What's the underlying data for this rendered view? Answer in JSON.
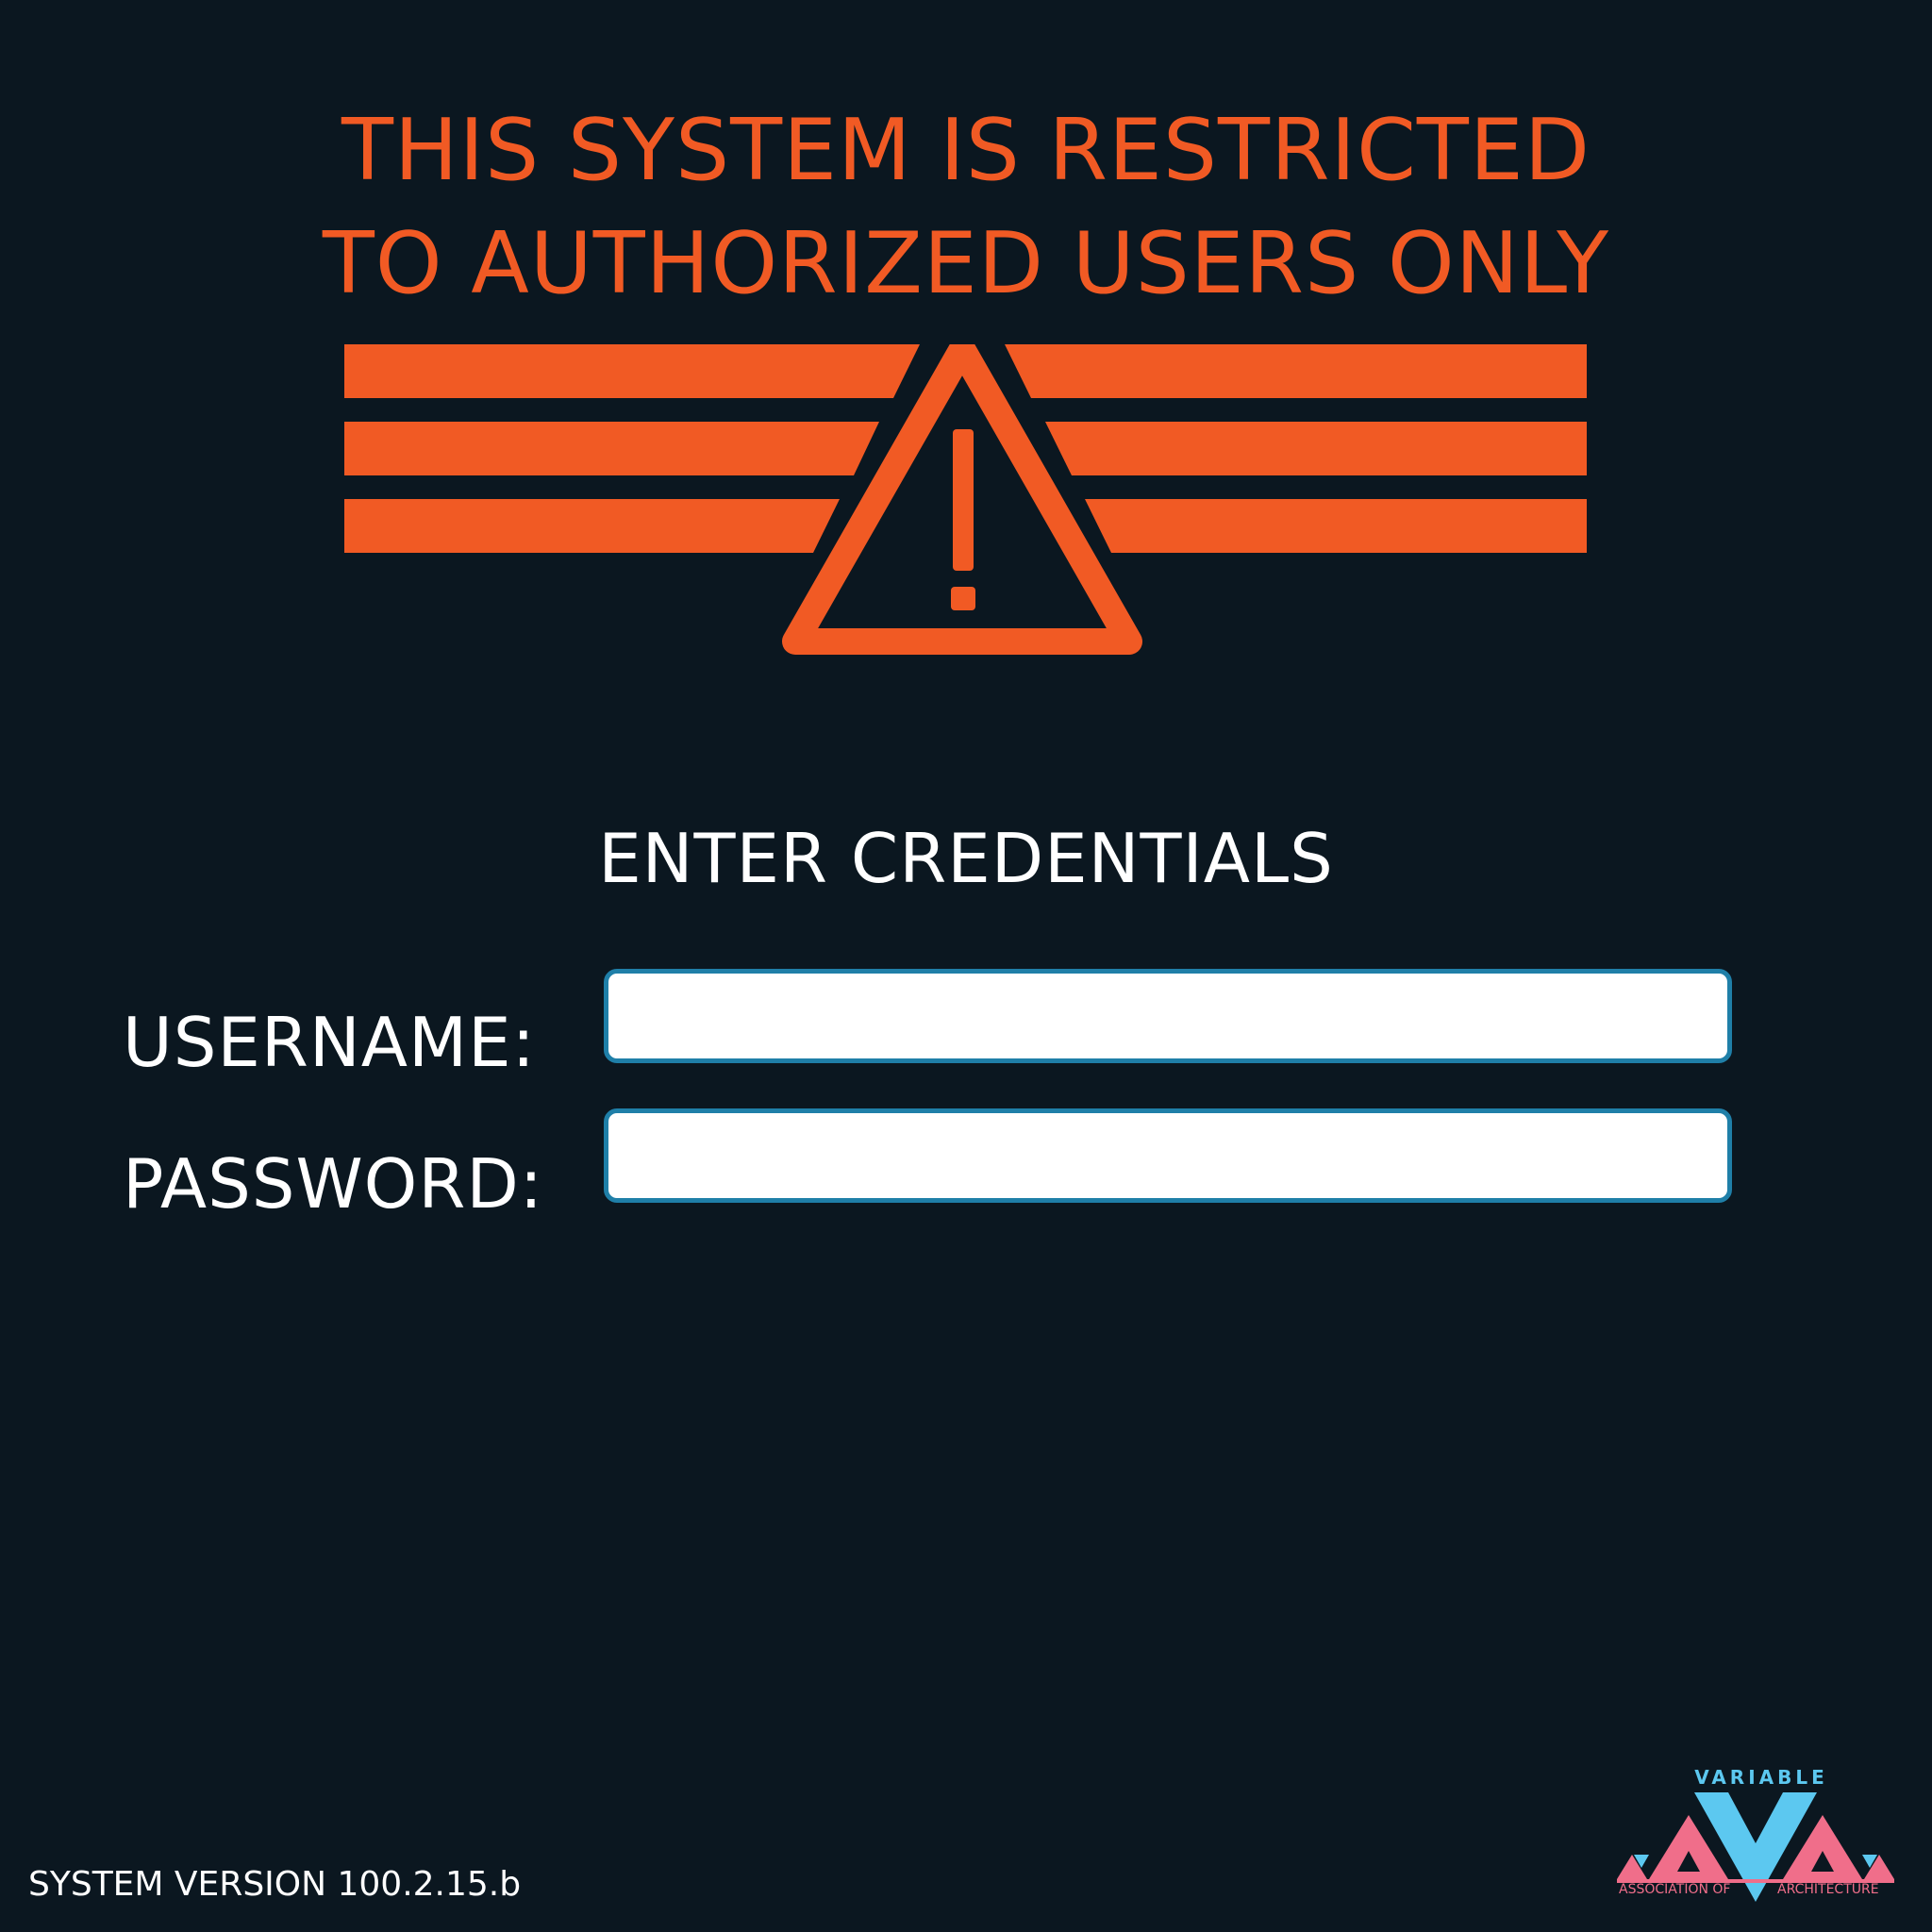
{
  "warning": {
    "line1": "THIS SYSTEM IS RESTRICTED",
    "line2": "TO AUTHORIZED USERS ONLY",
    "icon": "warning-triangle-icon"
  },
  "login": {
    "heading": "ENTER CREDENTIALS",
    "username_label": "USERNAME:",
    "username_value": "",
    "password_label": "PASSWORD:",
    "password_value": ""
  },
  "footer": {
    "version": "SYSTEM VERSION 100.2.15.b",
    "logo_top": "VARIABLE",
    "logo_left": "ASSOCIATION OF",
    "logo_right": "ARCHITECTURE"
  },
  "colors": {
    "background": "#0b1720",
    "warning": "#f15a24",
    "text": "#ffffff",
    "input_border": "#1f7fa8",
    "logo_blue": "#5cc8f0",
    "logo_pink": "#f06e8a"
  }
}
